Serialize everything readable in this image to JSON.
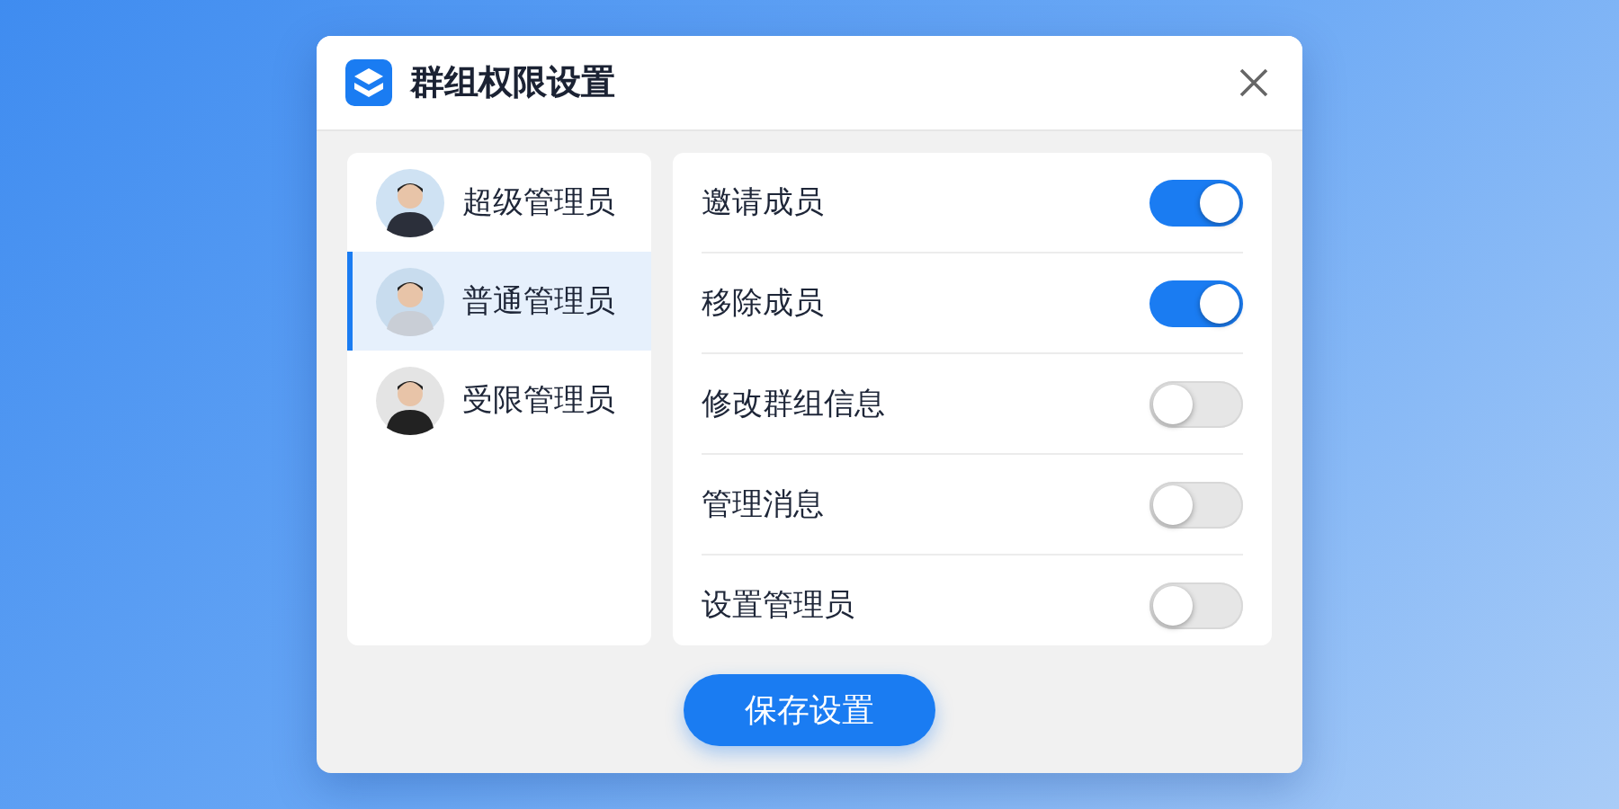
{
  "window": {
    "title": "群组权限设置"
  },
  "roles": [
    {
      "name": "超级管理员",
      "selected": false
    },
    {
      "name": "普通管理员",
      "selected": true
    },
    {
      "name": "受限管理员",
      "selected": false
    }
  ],
  "permissions": [
    {
      "label": "邀请成员",
      "on": true
    },
    {
      "label": "移除成员",
      "on": true
    },
    {
      "label": "修改群组信息",
      "on": false
    },
    {
      "label": "管理消息",
      "on": false
    },
    {
      "label": "设置管理员",
      "on": false
    }
  ],
  "save_button": "保存设置"
}
